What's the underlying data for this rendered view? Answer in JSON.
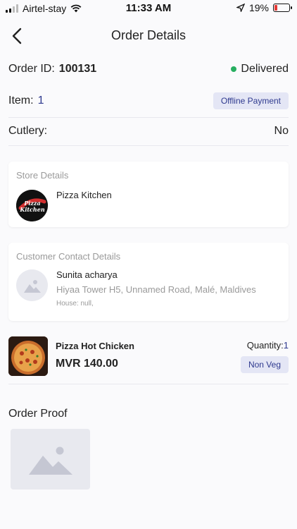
{
  "status_bar": {
    "carrier": "Airtel-stay",
    "time": "11:33 AM",
    "battery": "19%",
    "battery_level": 0.19
  },
  "header": {
    "title": "Order Details",
    "back_icon": "chevron-left-icon"
  },
  "order": {
    "id_label": "Order ID:",
    "id_value": "100131",
    "status": "Delivered",
    "status_color": "#27ae60",
    "item_label": "Item:",
    "item_count": "1",
    "payment_badge": "Offline Payment",
    "cutlery_label": "Cutlery:",
    "cutlery_value": "No"
  },
  "store": {
    "section_title": "Store Details",
    "name": "Pizza Kitchen",
    "logo_text_line1": "Pizza",
    "logo_text_line2": "Kitchen"
  },
  "customer": {
    "section_title": "Customer Contact Details",
    "name": "Sunita acharya",
    "address": "Hiyaa Tower H5, Unnamed Road, Malé, Maldives",
    "house": "House: null,"
  },
  "item": {
    "name": "Pizza Hot Chicken",
    "price": "MVR 140.00",
    "quantity_label": "Quantity:",
    "quantity_value": "1",
    "tag": "Non Veg"
  },
  "proof": {
    "title": "Order Proof"
  },
  "colors": {
    "accent": "#2f3a8f",
    "badge_bg": "#e4e6f5"
  }
}
